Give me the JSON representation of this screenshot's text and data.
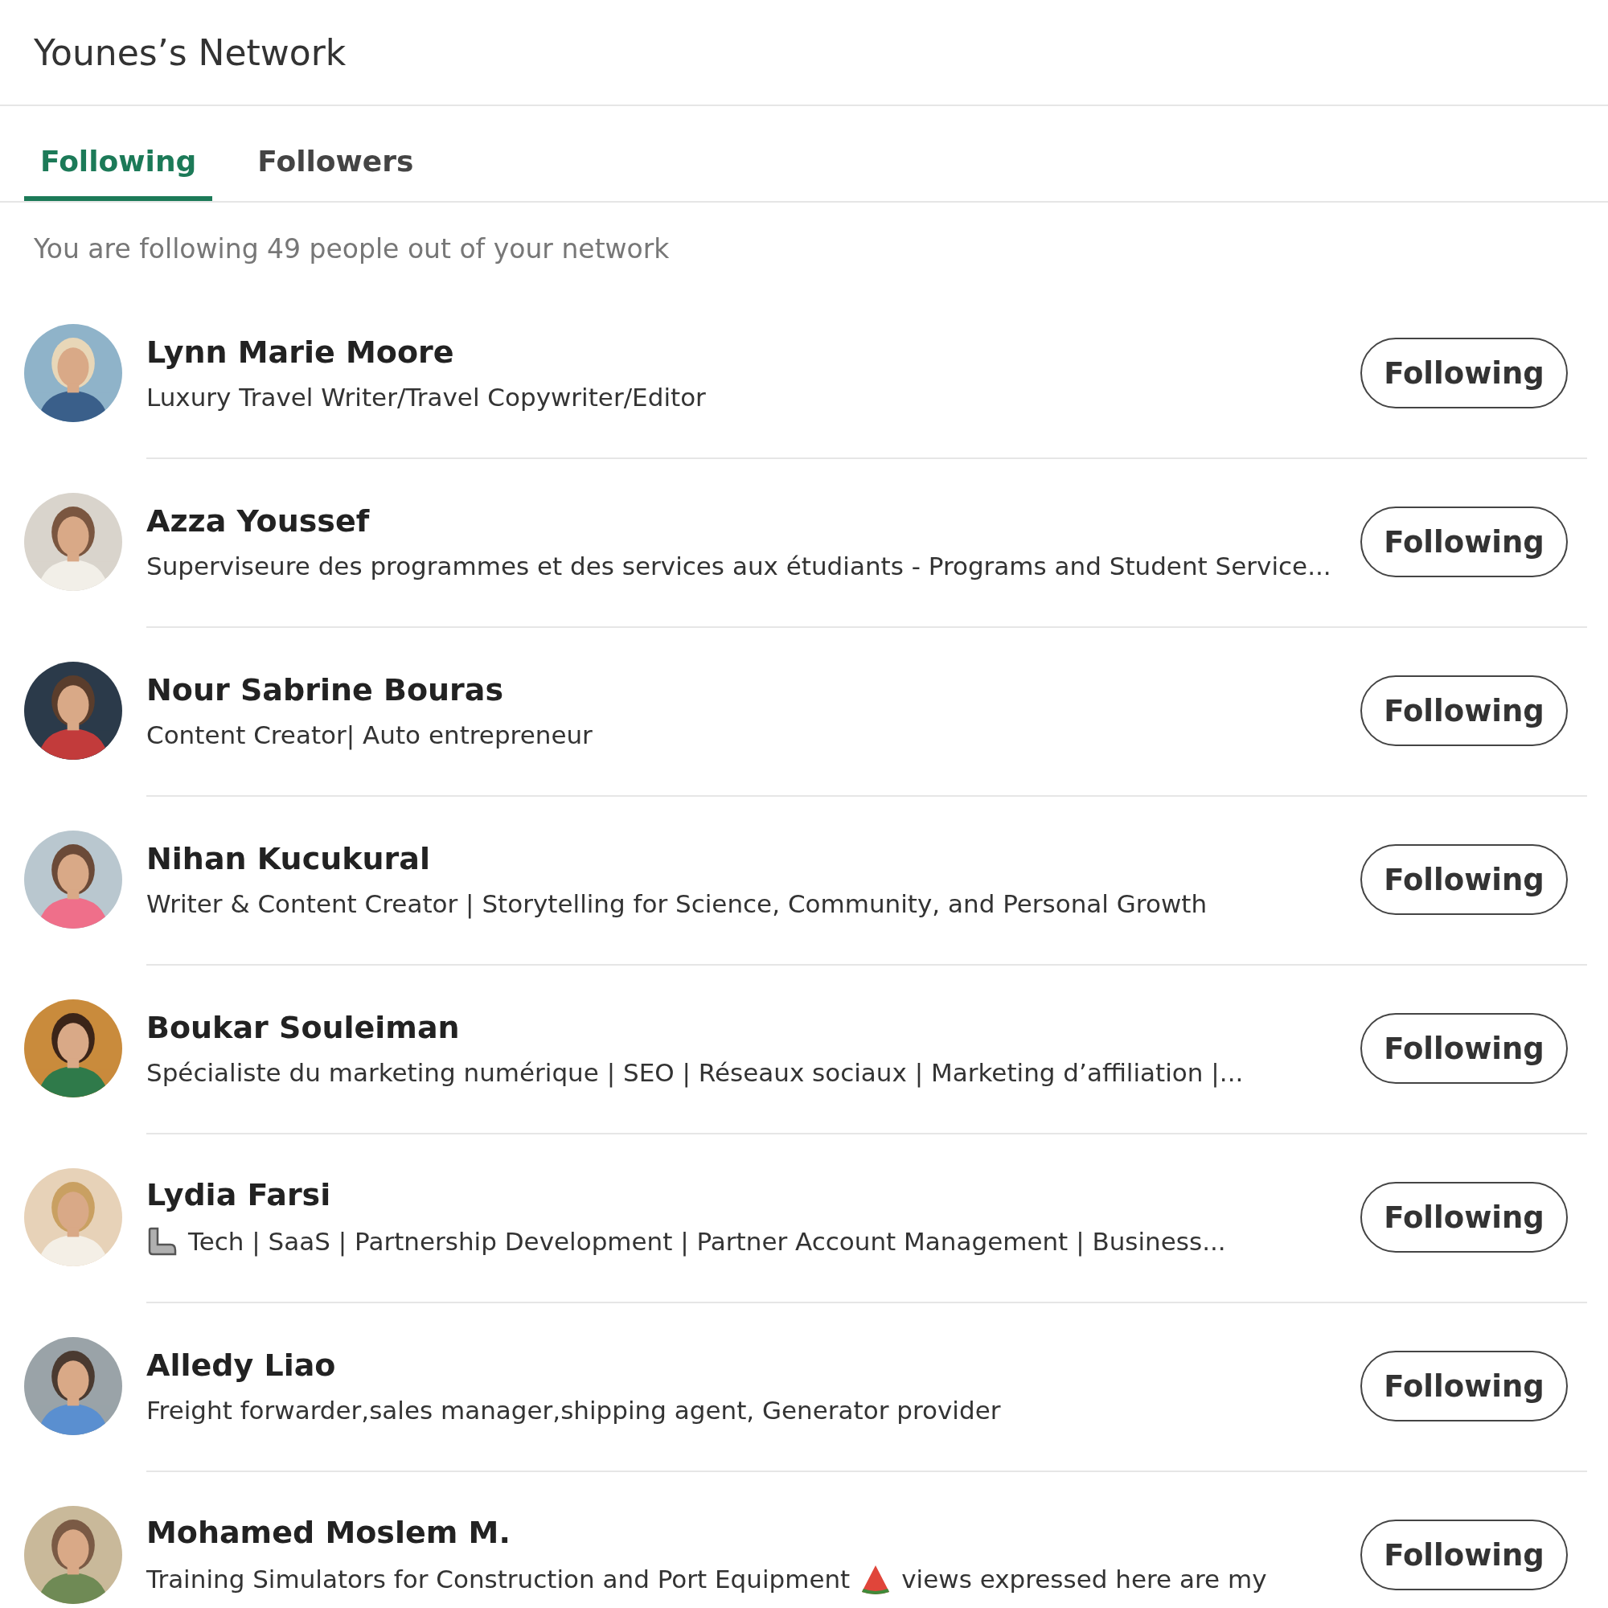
{
  "header": {
    "title": "Younes’s Network"
  },
  "tabs": [
    {
      "label": "Following",
      "selected": true
    },
    {
      "label": "Followers",
      "selected": false
    }
  ],
  "summary": "You are following 49 people out of your network",
  "people": [
    {
      "name": "Lynn Marie Moore",
      "headline": [
        {
          "kind": "text",
          "text": "Luxury Travel Writer/Travel Copywriter/Editor"
        }
      ],
      "button": "Following"
    },
    {
      "name": "Azza Youssef",
      "headline": [
        {
          "kind": "text",
          "text": "Superviseure des programmes et des services aux étudiants - Programs and Student Service..."
        }
      ],
      "button": "Following"
    },
    {
      "name": "Nour Sabrine Bouras",
      "headline": [
        {
          "kind": "text",
          "text": "Content Creator| Auto entrepreneur"
        }
      ],
      "button": "Following"
    },
    {
      "name": "Nihan Kucukural",
      "headline": [
        {
          "kind": "text",
          "text": "Writer & Content Creator | Storytelling for Science, Community, and Personal Growth"
        }
      ],
      "button": "Following"
    },
    {
      "name": "Boukar Souleiman",
      "headline": [
        {
          "kind": "text",
          "text": "Spécialiste du marketing numérique | SEO | Réseaux sociaux | Marketing d’affiliation |..."
        }
      ],
      "button": "Following"
    },
    {
      "name": "Lydia Farsi",
      "headline": [
        {
          "kind": "arm"
        },
        {
          "kind": "text",
          "text": "Tech | SaaS | Partnership Development | Partner Account Management | Business..."
        }
      ],
      "button": "Following"
    },
    {
      "name": "Alledy Liao",
      "headline": [
        {
          "kind": "text",
          "text": "Freight forwarder,sales manager,shipping agent, Generator provider"
        }
      ],
      "button": "Following"
    },
    {
      "name": "Mohamed Moslem M.",
      "headline": [
        {
          "kind": "text",
          "text": "Training Simulators for Construction and Port Equipment"
        },
        {
          "kind": "slice"
        },
        {
          "kind": "text",
          "text": "views expressed here are my"
        }
      ],
      "button": "Following"
    }
  ]
}
